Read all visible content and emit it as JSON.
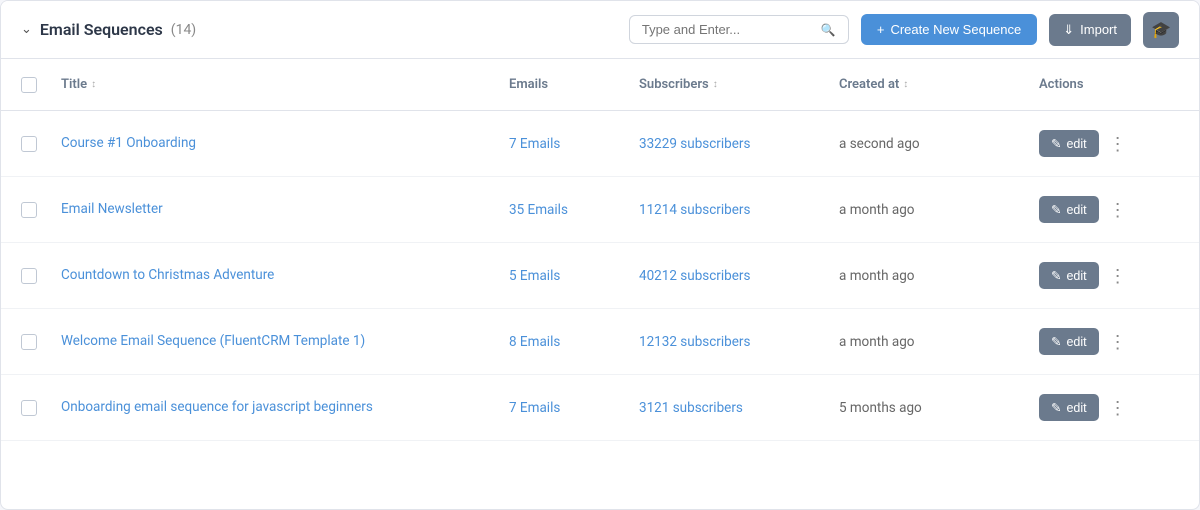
{
  "header": {
    "title": "Email Sequences",
    "count": "(14)",
    "search_placeholder": "Type and Enter...",
    "create_label": "Create New Sequence",
    "import_label": "Import"
  },
  "table": {
    "columns": {
      "title": "Title",
      "emails": "Emails",
      "subscribers": "Subscribers",
      "created_at": "Created at",
      "actions": "Actions"
    },
    "rows": [
      {
        "title": "Course #1 Onboarding",
        "emails": "7 Emails",
        "subscribers": "33229 subscribers",
        "created": "a second ago"
      },
      {
        "title": "Email Newsletter",
        "emails": "35 Emails",
        "subscribers": "11214 subscribers",
        "created": "a month ago"
      },
      {
        "title": "Countdown to Christmas Adventure",
        "emails": "5 Emails",
        "subscribers": "40212 subscribers",
        "created": "a month ago"
      },
      {
        "title": "Welcome Email Sequence (FluentCRM Template 1)",
        "emails": "8 Emails",
        "subscribers": "12132 subscribers",
        "created": "a month ago"
      },
      {
        "title": "Onboarding email sequence for javascript beginners",
        "emails": "7 Emails",
        "subscribers": "3121 subscribers",
        "created": "5 months ago"
      }
    ],
    "edit_label": "edit"
  }
}
